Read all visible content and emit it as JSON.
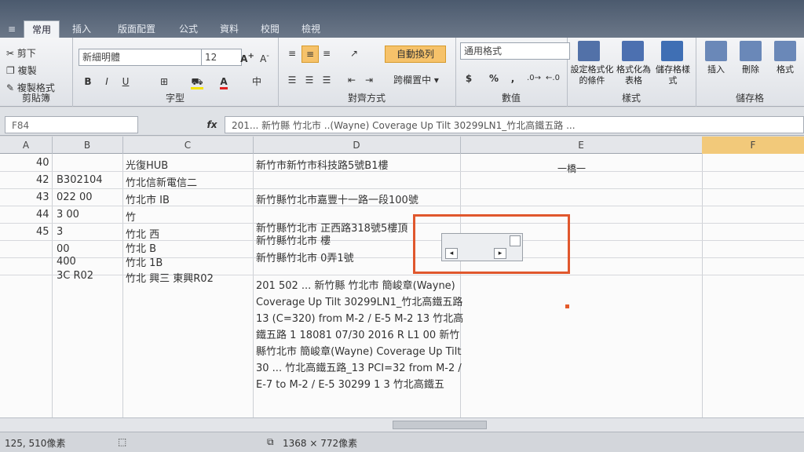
{
  "ribbon_tabs": [
    "常用",
    "插入",
    "版面配置",
    "公式",
    "資料",
    "校閱",
    "檢視"
  ],
  "clipboard": {
    "cut": "剪下",
    "copy": "複製",
    "format_painter": "複製格式",
    "label": "剪貼簿"
  },
  "font": {
    "name": "新細明體",
    "size": "12",
    "label": "字型",
    "font_color_btn": "A",
    "bold": "B",
    "italic": "I",
    "underline": "U"
  },
  "alignment": {
    "wrap_text": "自動換列",
    "merge_center": "跨欄置中",
    "label": "對齊方式"
  },
  "number": {
    "format": "通用格式",
    "currency": "$",
    "percent": "%",
    "comma": ",",
    "label": "數值"
  },
  "styles": {
    "conditional": "設定格式化的條件",
    "format_as_table": "格式化為表格",
    "cell_styles": "儲存格樣式",
    "label": "樣式"
  },
  "cells": {
    "insert": "插入",
    "delete": "刪除",
    "format": "格式",
    "label": "儲存格"
  },
  "formula_bar": {
    "name_box": "F84",
    "fx": "fx",
    "formula": "201... 新竹縣 竹北市 ..(Wayne) Coverage Up Tilt 30299LN1_竹北高鐵五路 ..."
  },
  "columns": [
    "A",
    "B",
    "C",
    "D",
    "E",
    "F"
  ],
  "rows": [
    {
      "a": "40",
      "b": "",
      "c": "光復HUB",
      "d": "新竹市新竹市科技路5號B1樓"
    },
    {
      "a": "42",
      "b": "B302104",
      "c": "竹北信新電信二",
      "d": ""
    },
    {
      "a": "43",
      "b": "022  00",
      "c": "竹北市  IB",
      "d": "新竹縣竹北市嘉豐十一路一段100號"
    },
    {
      "a": "44",
      "b": "3  00",
      "c": "竹",
      "d": ""
    },
    {
      "a": "45",
      "b": "3",
      "c": "竹北  西",
      "d": "新竹縣竹北市  正西路318號5樓頂"
    },
    {
      "a": "",
      "b": "  00",
      "c": "竹北  B",
      "d": "新竹縣竹北市  樓"
    },
    {
      "a": "",
      "b": "  400",
      "c": "竹北  1B",
      "d": "新竹縣竹北市  0弄1號"
    },
    {
      "a": "",
      "b": "3C  R02",
      "c": "竹北  興三  東興R02",
      "d": ""
    }
  ],
  "e_note": "一橋一",
  "wrapped_text": "201 502 ... 新竹縣 竹北市 簡峻章(Wayne) Coverage Up Tilt 30299LN1_竹北高鐵五路 13 (C=320) from M-2 / E-5 M-2 13 竹北高鐵五路 1 18081 07/30 2016 R L1 00 新竹縣竹北市 簡峻章(Wayne) Coverage Up Tilt 30 ... 竹北高鐵五路_13 PCI=32 from M-2 / E-7 to M-2 / E-5 30299 1 3 竹北高鐵五",
  "status": {
    "coords": "125, 510像素",
    "size": "1368 × 772像素"
  }
}
